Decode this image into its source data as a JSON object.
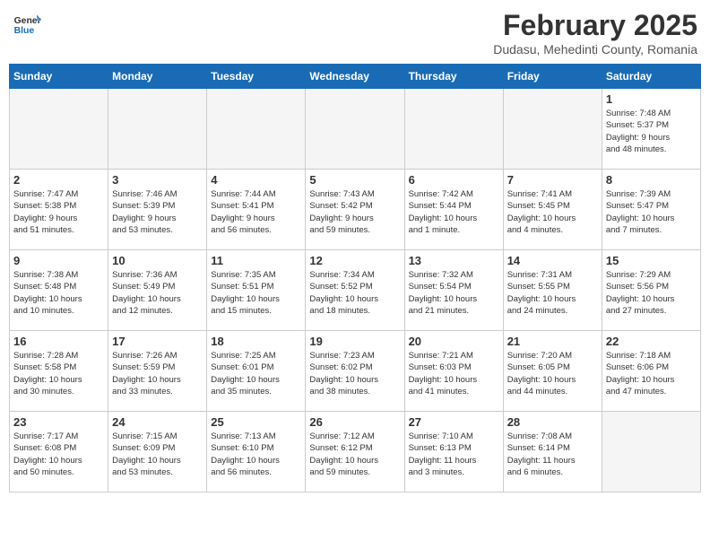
{
  "header": {
    "logo_line1": "General",
    "logo_line2": "Blue",
    "month_year": "February 2025",
    "location": "Dudasu, Mehedinti County, Romania"
  },
  "weekdays": [
    "Sunday",
    "Monday",
    "Tuesday",
    "Wednesday",
    "Thursday",
    "Friday",
    "Saturday"
  ],
  "weeks": [
    [
      {
        "day": "",
        "info": ""
      },
      {
        "day": "",
        "info": ""
      },
      {
        "day": "",
        "info": ""
      },
      {
        "day": "",
        "info": ""
      },
      {
        "day": "",
        "info": ""
      },
      {
        "day": "",
        "info": ""
      },
      {
        "day": "1",
        "info": "Sunrise: 7:48 AM\nSunset: 5:37 PM\nDaylight: 9 hours\nand 48 minutes."
      }
    ],
    [
      {
        "day": "2",
        "info": "Sunrise: 7:47 AM\nSunset: 5:38 PM\nDaylight: 9 hours\nand 51 minutes."
      },
      {
        "day": "3",
        "info": "Sunrise: 7:46 AM\nSunset: 5:39 PM\nDaylight: 9 hours\nand 53 minutes."
      },
      {
        "day": "4",
        "info": "Sunrise: 7:44 AM\nSunset: 5:41 PM\nDaylight: 9 hours\nand 56 minutes."
      },
      {
        "day": "5",
        "info": "Sunrise: 7:43 AM\nSunset: 5:42 PM\nDaylight: 9 hours\nand 59 minutes."
      },
      {
        "day": "6",
        "info": "Sunrise: 7:42 AM\nSunset: 5:44 PM\nDaylight: 10 hours\nand 1 minute."
      },
      {
        "day": "7",
        "info": "Sunrise: 7:41 AM\nSunset: 5:45 PM\nDaylight: 10 hours\nand 4 minutes."
      },
      {
        "day": "8",
        "info": "Sunrise: 7:39 AM\nSunset: 5:47 PM\nDaylight: 10 hours\nand 7 minutes."
      }
    ],
    [
      {
        "day": "9",
        "info": "Sunrise: 7:38 AM\nSunset: 5:48 PM\nDaylight: 10 hours\nand 10 minutes."
      },
      {
        "day": "10",
        "info": "Sunrise: 7:36 AM\nSunset: 5:49 PM\nDaylight: 10 hours\nand 12 minutes."
      },
      {
        "day": "11",
        "info": "Sunrise: 7:35 AM\nSunset: 5:51 PM\nDaylight: 10 hours\nand 15 minutes."
      },
      {
        "day": "12",
        "info": "Sunrise: 7:34 AM\nSunset: 5:52 PM\nDaylight: 10 hours\nand 18 minutes."
      },
      {
        "day": "13",
        "info": "Sunrise: 7:32 AM\nSunset: 5:54 PM\nDaylight: 10 hours\nand 21 minutes."
      },
      {
        "day": "14",
        "info": "Sunrise: 7:31 AM\nSunset: 5:55 PM\nDaylight: 10 hours\nand 24 minutes."
      },
      {
        "day": "15",
        "info": "Sunrise: 7:29 AM\nSunset: 5:56 PM\nDaylight: 10 hours\nand 27 minutes."
      }
    ],
    [
      {
        "day": "16",
        "info": "Sunrise: 7:28 AM\nSunset: 5:58 PM\nDaylight: 10 hours\nand 30 minutes."
      },
      {
        "day": "17",
        "info": "Sunrise: 7:26 AM\nSunset: 5:59 PM\nDaylight: 10 hours\nand 33 minutes."
      },
      {
        "day": "18",
        "info": "Sunrise: 7:25 AM\nSunset: 6:01 PM\nDaylight: 10 hours\nand 35 minutes."
      },
      {
        "day": "19",
        "info": "Sunrise: 7:23 AM\nSunset: 6:02 PM\nDaylight: 10 hours\nand 38 minutes."
      },
      {
        "day": "20",
        "info": "Sunrise: 7:21 AM\nSunset: 6:03 PM\nDaylight: 10 hours\nand 41 minutes."
      },
      {
        "day": "21",
        "info": "Sunrise: 7:20 AM\nSunset: 6:05 PM\nDaylight: 10 hours\nand 44 minutes."
      },
      {
        "day": "22",
        "info": "Sunrise: 7:18 AM\nSunset: 6:06 PM\nDaylight: 10 hours\nand 47 minutes."
      }
    ],
    [
      {
        "day": "23",
        "info": "Sunrise: 7:17 AM\nSunset: 6:08 PM\nDaylight: 10 hours\nand 50 minutes."
      },
      {
        "day": "24",
        "info": "Sunrise: 7:15 AM\nSunset: 6:09 PM\nDaylight: 10 hours\nand 53 minutes."
      },
      {
        "day": "25",
        "info": "Sunrise: 7:13 AM\nSunset: 6:10 PM\nDaylight: 10 hours\nand 56 minutes."
      },
      {
        "day": "26",
        "info": "Sunrise: 7:12 AM\nSunset: 6:12 PM\nDaylight: 10 hours\nand 59 minutes."
      },
      {
        "day": "27",
        "info": "Sunrise: 7:10 AM\nSunset: 6:13 PM\nDaylight: 11 hours\nand 3 minutes."
      },
      {
        "day": "28",
        "info": "Sunrise: 7:08 AM\nSunset: 6:14 PM\nDaylight: 11 hours\nand 6 minutes."
      },
      {
        "day": "",
        "info": ""
      }
    ]
  ]
}
